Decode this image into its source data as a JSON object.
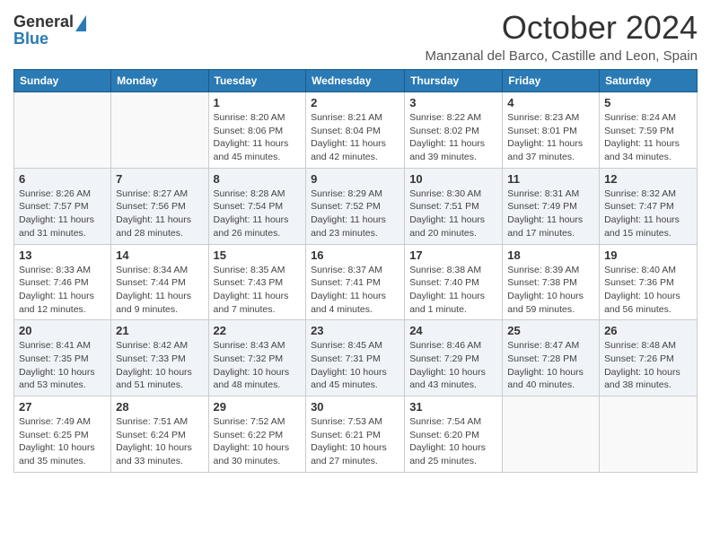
{
  "logo": {
    "general": "General",
    "blue": "Blue"
  },
  "title": "October 2024",
  "location": "Manzanal del Barco, Castille and Leon, Spain",
  "days_of_week": [
    "Sunday",
    "Monday",
    "Tuesday",
    "Wednesday",
    "Thursday",
    "Friday",
    "Saturday"
  ],
  "weeks": [
    [
      {
        "day": "",
        "info": ""
      },
      {
        "day": "",
        "info": ""
      },
      {
        "day": "1",
        "info": "Sunrise: 8:20 AM\nSunset: 8:06 PM\nDaylight: 11 hours and 45 minutes."
      },
      {
        "day": "2",
        "info": "Sunrise: 8:21 AM\nSunset: 8:04 PM\nDaylight: 11 hours and 42 minutes."
      },
      {
        "day": "3",
        "info": "Sunrise: 8:22 AM\nSunset: 8:02 PM\nDaylight: 11 hours and 39 minutes."
      },
      {
        "day": "4",
        "info": "Sunrise: 8:23 AM\nSunset: 8:01 PM\nDaylight: 11 hours and 37 minutes."
      },
      {
        "day": "5",
        "info": "Sunrise: 8:24 AM\nSunset: 7:59 PM\nDaylight: 11 hours and 34 minutes."
      }
    ],
    [
      {
        "day": "6",
        "info": "Sunrise: 8:26 AM\nSunset: 7:57 PM\nDaylight: 11 hours and 31 minutes."
      },
      {
        "day": "7",
        "info": "Sunrise: 8:27 AM\nSunset: 7:56 PM\nDaylight: 11 hours and 28 minutes."
      },
      {
        "day": "8",
        "info": "Sunrise: 8:28 AM\nSunset: 7:54 PM\nDaylight: 11 hours and 26 minutes."
      },
      {
        "day": "9",
        "info": "Sunrise: 8:29 AM\nSunset: 7:52 PM\nDaylight: 11 hours and 23 minutes."
      },
      {
        "day": "10",
        "info": "Sunrise: 8:30 AM\nSunset: 7:51 PM\nDaylight: 11 hours and 20 minutes."
      },
      {
        "day": "11",
        "info": "Sunrise: 8:31 AM\nSunset: 7:49 PM\nDaylight: 11 hours and 17 minutes."
      },
      {
        "day": "12",
        "info": "Sunrise: 8:32 AM\nSunset: 7:47 PM\nDaylight: 11 hours and 15 minutes."
      }
    ],
    [
      {
        "day": "13",
        "info": "Sunrise: 8:33 AM\nSunset: 7:46 PM\nDaylight: 11 hours and 12 minutes."
      },
      {
        "day": "14",
        "info": "Sunrise: 8:34 AM\nSunset: 7:44 PM\nDaylight: 11 hours and 9 minutes."
      },
      {
        "day": "15",
        "info": "Sunrise: 8:35 AM\nSunset: 7:43 PM\nDaylight: 11 hours and 7 minutes."
      },
      {
        "day": "16",
        "info": "Sunrise: 8:37 AM\nSunset: 7:41 PM\nDaylight: 11 hours and 4 minutes."
      },
      {
        "day": "17",
        "info": "Sunrise: 8:38 AM\nSunset: 7:40 PM\nDaylight: 11 hours and 1 minute."
      },
      {
        "day": "18",
        "info": "Sunrise: 8:39 AM\nSunset: 7:38 PM\nDaylight: 10 hours and 59 minutes."
      },
      {
        "day": "19",
        "info": "Sunrise: 8:40 AM\nSunset: 7:36 PM\nDaylight: 10 hours and 56 minutes."
      }
    ],
    [
      {
        "day": "20",
        "info": "Sunrise: 8:41 AM\nSunset: 7:35 PM\nDaylight: 10 hours and 53 minutes."
      },
      {
        "day": "21",
        "info": "Sunrise: 8:42 AM\nSunset: 7:33 PM\nDaylight: 10 hours and 51 minutes."
      },
      {
        "day": "22",
        "info": "Sunrise: 8:43 AM\nSunset: 7:32 PM\nDaylight: 10 hours and 48 minutes."
      },
      {
        "day": "23",
        "info": "Sunrise: 8:45 AM\nSunset: 7:31 PM\nDaylight: 10 hours and 45 minutes."
      },
      {
        "day": "24",
        "info": "Sunrise: 8:46 AM\nSunset: 7:29 PM\nDaylight: 10 hours and 43 minutes."
      },
      {
        "day": "25",
        "info": "Sunrise: 8:47 AM\nSunset: 7:28 PM\nDaylight: 10 hours and 40 minutes."
      },
      {
        "day": "26",
        "info": "Sunrise: 8:48 AM\nSunset: 7:26 PM\nDaylight: 10 hours and 38 minutes."
      }
    ],
    [
      {
        "day": "27",
        "info": "Sunrise: 7:49 AM\nSunset: 6:25 PM\nDaylight: 10 hours and 35 minutes."
      },
      {
        "day": "28",
        "info": "Sunrise: 7:51 AM\nSunset: 6:24 PM\nDaylight: 10 hours and 33 minutes."
      },
      {
        "day": "29",
        "info": "Sunrise: 7:52 AM\nSunset: 6:22 PM\nDaylight: 10 hours and 30 minutes."
      },
      {
        "day": "30",
        "info": "Sunrise: 7:53 AM\nSunset: 6:21 PM\nDaylight: 10 hours and 27 minutes."
      },
      {
        "day": "31",
        "info": "Sunrise: 7:54 AM\nSunset: 6:20 PM\nDaylight: 10 hours and 25 minutes."
      },
      {
        "day": "",
        "info": ""
      },
      {
        "day": "",
        "info": ""
      }
    ]
  ]
}
